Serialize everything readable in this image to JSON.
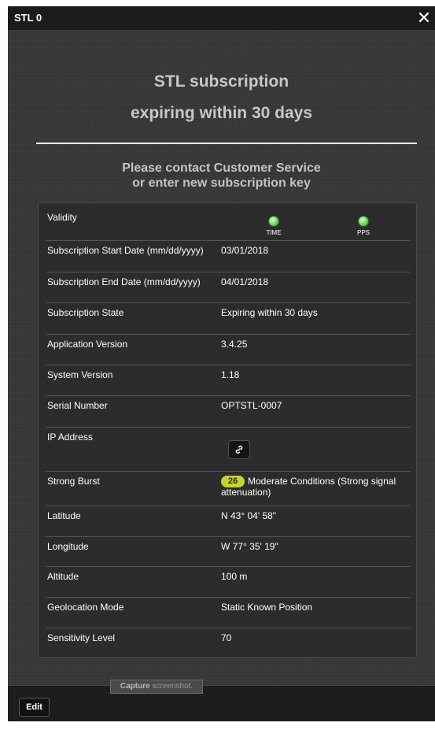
{
  "window": {
    "title": "STL 0",
    "close_glyph": "✕"
  },
  "header": {
    "headline_line1": "STL subscription",
    "headline_line2": "expiring within 30 days",
    "contact_line1": "Please contact Customer Service",
    "contact_line2": "or enter new subscription key"
  },
  "details": {
    "validity": {
      "label": "Validity",
      "indicators": [
        {
          "label": "TIME",
          "status": "ok",
          "color": "#7de06a"
        },
        {
          "label": "PPS",
          "status": "ok",
          "color": "#7de06a"
        }
      ]
    },
    "start_date": {
      "label": "Subscription Start Date (mm/dd/yyyy)",
      "value": "03/01/2018"
    },
    "end_date": {
      "label": "Subscription End Date (mm/dd/yyyy)",
      "value": "04/01/2018"
    },
    "state": {
      "label": "Subscription State",
      "value": "Expiring within 30 days"
    },
    "app_version": {
      "label": "Application Version",
      "value": "3.4.25"
    },
    "system_version": {
      "label": "System Version",
      "value": "1.18"
    },
    "serial": {
      "label": "Serial Number",
      "value": "OPTSTL-0007"
    },
    "ip": {
      "label": "IP Address",
      "button_icon": "link-icon"
    },
    "strong_burst": {
      "label": "Strong Burst",
      "badge_value": "26",
      "badge_color": "#c6d42a",
      "description": "Moderate Conditions (Strong signal attenuation)"
    },
    "latitude": {
      "label": "Latitude",
      "value": "N 43° 04' 58\""
    },
    "longitude": {
      "label": "Longitude",
      "value": "W 77° 35' 19\""
    },
    "altitude": {
      "label": "Altitude",
      "value": "100 m"
    },
    "geolocation": {
      "label": "Geolocation Mode",
      "value": "Static Known Position"
    },
    "sensitivity": {
      "label": "Sensitivity Level",
      "value": "70"
    }
  },
  "footer": {
    "edit_label": "Edit"
  },
  "tooltip": {
    "bold": "Capture",
    "rest": " screenshot."
  }
}
